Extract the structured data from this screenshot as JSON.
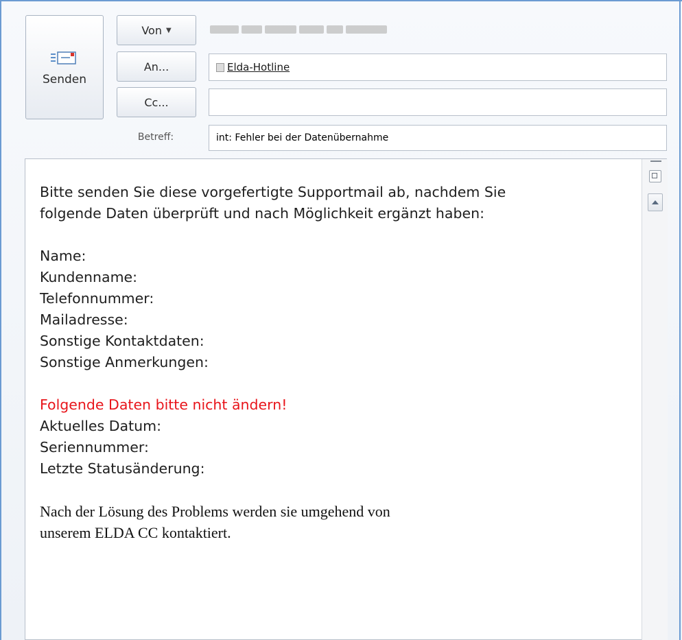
{
  "toolbar": {
    "send_label": "Senden",
    "from_label": "Von",
    "to_label": "An...",
    "cc_label": "Cc...",
    "subject_label": "Betreff:"
  },
  "fields": {
    "to_recipient": "Elda-Hotline",
    "cc_value": "",
    "subject_value": "int: Fehler bei der Datenübernahme"
  },
  "body": {
    "intro_line1": "Bitte senden Sie diese vorgefertigte Supportmail ab, nachdem Sie",
    "intro_line2": "folgende Daten überprüft und nach Möglichkeit ergänzt haben:",
    "fields": [
      "Name:",
      "Kundenname:",
      "Telefonnummer:",
      "Mailadresse:",
      "Sonstige Kontaktdaten:",
      "Sonstige Anmerkungen:"
    ],
    "warning": "Folgende Daten bitte nicht ändern!",
    "system_fields": [
      "Aktuelles Datum:",
      "Seriennummer:",
      "Letzte Statusänderung:"
    ],
    "closing_line1": "Nach der Lösung des Problems werden sie umgehend von",
    "closing_line2": "unserem ELDA CC kontaktiert."
  },
  "colors": {
    "warning": "#e8151b",
    "frame_border": "#6b9bd2"
  },
  "icons": {
    "send": "mail-send-icon",
    "recipient": "contact-card-icon",
    "dropdown": "caret-down-icon",
    "expand": "expand-pane-icon",
    "scroll_up": "arrow-up-icon"
  }
}
